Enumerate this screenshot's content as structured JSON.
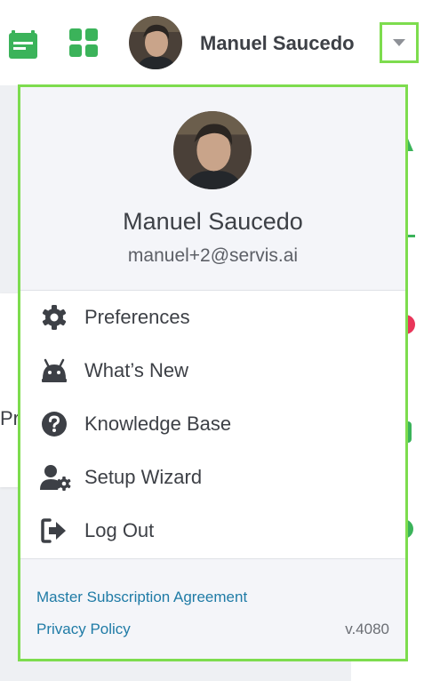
{
  "colors": {
    "brand_green": "#3bb35a",
    "highlight_green": "#7ddc4e",
    "link_blue": "#1f7ba6",
    "text_dark": "#3d4046"
  },
  "header": {
    "user_name": "Manuel Saucedo",
    "icons": [
      "calendar-icon",
      "grid-icon",
      "chevron-down-icon"
    ]
  },
  "background": {
    "partial_text": "Pr"
  },
  "menu": {
    "profile": {
      "name": "Manuel Saucedo",
      "email": "manuel+2@servis.ai"
    },
    "items": [
      {
        "label": "Preferences",
        "icon": "gear-icon"
      },
      {
        "label": "What’s New",
        "icon": "whats-new-icon"
      },
      {
        "label": "Knowledge Base",
        "icon": "question-icon"
      },
      {
        "label": "Setup Wizard",
        "icon": "user-cog-icon"
      },
      {
        "label": "Log Out",
        "icon": "logout-icon"
      }
    ],
    "footer": {
      "msa_link": "Master Subscription Agreement",
      "privacy_link": "Privacy Policy",
      "version": "v.4080"
    }
  }
}
